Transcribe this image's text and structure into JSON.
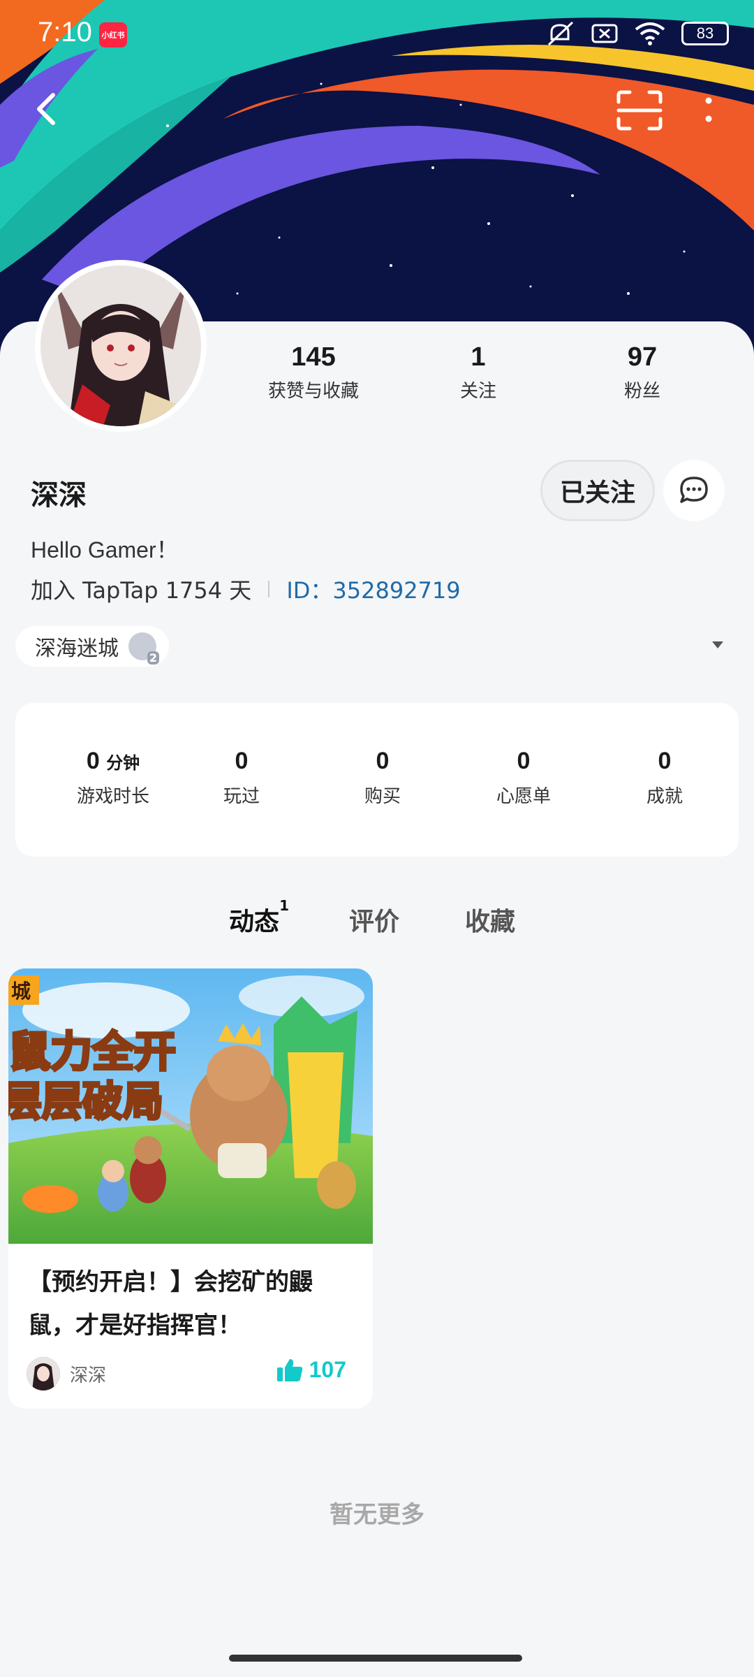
{
  "status_bar": {
    "time": "7:10",
    "app_badge": "小红书",
    "battery": "83"
  },
  "profile": {
    "username": "深深",
    "bio": "Hello Gamer！",
    "joined": "加入 TapTap 1754 天",
    "id_label": "ID：352892719",
    "follow_button": "已关注",
    "guild_name": "深海迷城",
    "guild_level": "2"
  },
  "stats": [
    {
      "num": "145",
      "label": "获赞与收藏"
    },
    {
      "num": "1",
      "label": "关注"
    },
    {
      "num": "97",
      "label": "粉丝"
    }
  ],
  "game_stats": {
    "playtime_num": "0",
    "playtime_unit": "分钟",
    "playtime_label": "游戏时长",
    "played_num": "0",
    "played_label": "玩过",
    "bought_num": "0",
    "bought_label": "购买",
    "wishlist_num": "0",
    "wishlist_label": "心愿单",
    "achievements_num": "0",
    "achievements_label": "成就"
  },
  "tabs": {
    "moments": "动态",
    "moments_count": "1",
    "reviews": "评价",
    "favorites": "收藏"
  },
  "post": {
    "image_text_1": "鼠力全开",
    "image_text_2": "层层破局",
    "image_corner": "城",
    "title": "【预约开启！】会挖矿的鼹鼠，才是好指挥官！",
    "author": "深深",
    "likes": "107"
  },
  "footer": {
    "no_more": "暂无更多"
  },
  "colors": {
    "accent": "#14c9c9",
    "id_link": "#1f6aa8",
    "banner_bg": "#0b1244"
  }
}
